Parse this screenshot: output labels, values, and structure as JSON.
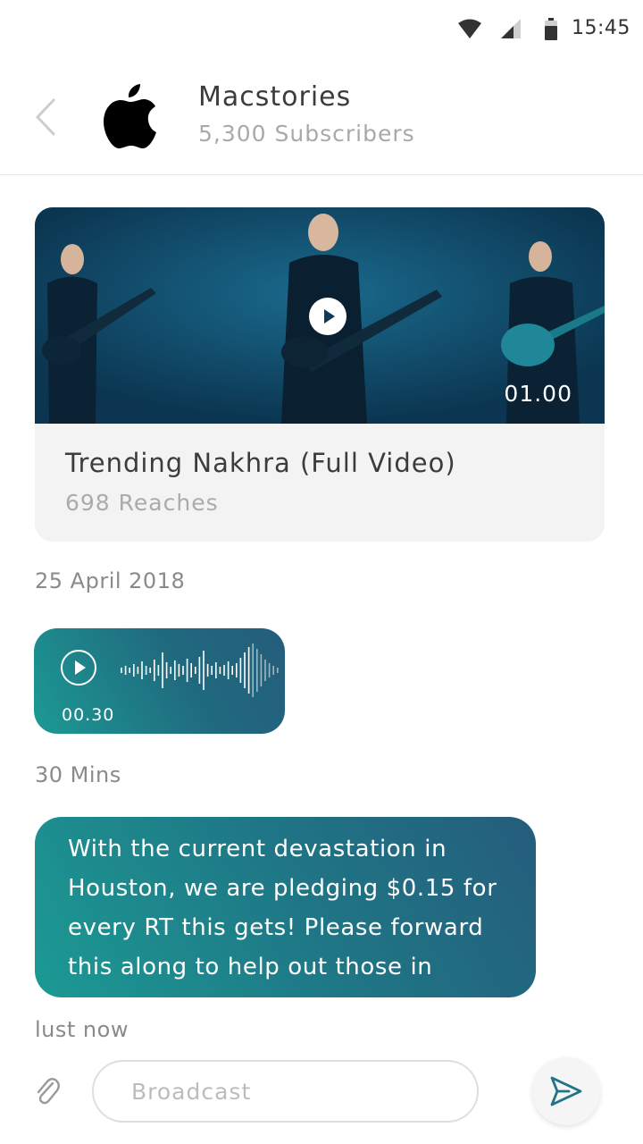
{
  "status_bar": {
    "time": "15:45",
    "icons": [
      "wifi-icon",
      "signal-icon",
      "battery-icon"
    ]
  },
  "header": {
    "back_icon": "chevron-left-icon",
    "logo": "apple-logo",
    "title": "Macstories",
    "subscribers": "5,300 Subscribers"
  },
  "video_post": {
    "duration": "01.00",
    "title": "Trending Nakhra (Full Video)",
    "reaches": "698 Reaches",
    "play_icon": "play-icon"
  },
  "timestamps": {
    "first": "25 April 2018",
    "second": "30 Mins",
    "third": "lust now"
  },
  "voice_message": {
    "duration": "00.30",
    "play_icon": "play-circle-icon"
  },
  "text_message": {
    "body": "With the current devastation in Houston, we are pledging $0.15 for every RT this gets! Please forward this along to help out those in"
  },
  "composer": {
    "attach_icon": "paperclip-icon",
    "placeholder": "Broadcast",
    "value": "",
    "send_icon": "send-icon"
  },
  "colors": {
    "accent": "#1f7585",
    "bubble_start": "#1c9a94",
    "bubble_end": "#255d7c",
    "video_bg": "#0f4d6e",
    "card_bg": "#f3f3f3",
    "muted_text": "#a9a9a9"
  }
}
